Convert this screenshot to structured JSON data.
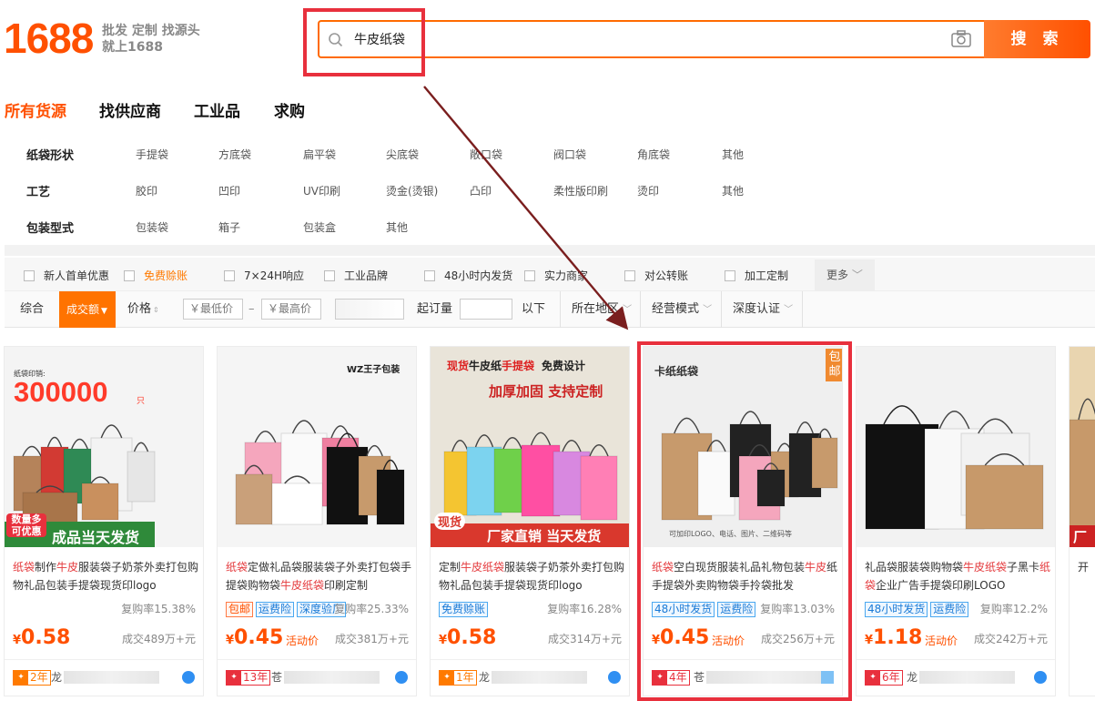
{
  "logo": {
    "number": "1688",
    "slogan_line1": "批发 定制 找源头",
    "slogan_line2": "就上1688"
  },
  "search": {
    "query": "牛皮纸袋",
    "button": "搜 索"
  },
  "tabs": [
    "所有货源",
    "找供应商",
    "工业品",
    "求购"
  ],
  "attributes": [
    {
      "label": "纸袋形状",
      "options": [
        "手提袋",
        "方底袋",
        "扁平袋",
        "尖底袋",
        "敞口袋",
        "阀口袋",
        "角底袋",
        "其他"
      ]
    },
    {
      "label": "工艺",
      "options": [
        "胶印",
        "凹印",
        "UV印刷",
        "烫金(烫银)",
        "凸印",
        "柔性版印刷",
        "烫印",
        "其他"
      ]
    },
    {
      "label": "包装型式",
      "options": [
        "包装袋",
        "箱子",
        "包装盒",
        "其他"
      ]
    }
  ],
  "filters": [
    "新人首单优惠",
    "免费赊账",
    "7×24H响应",
    "工业品牌",
    "48小时内发货",
    "实力商家",
    "对公转账",
    "加工定制"
  ],
  "filter_more": "更多",
  "sort": {
    "general": "综合",
    "volume": "成交额",
    "price": "价格",
    "min_price": "￥最低价",
    "dash": "–",
    "max_price": "￥最高价",
    "moq": "起订量",
    "below": "以下",
    "location": "所在地区",
    "business_mode": "经营模式",
    "certification": "深度认证"
  },
  "products": [
    {
      "title_parts": [
        [
          "纸袋",
          true
        ],
        [
          "制作",
          false
        ],
        [
          "牛皮",
          true
        ],
        [
          "服装袋子奶茶外卖打包购物礼品包装手提袋现货印logo",
          false
        ]
      ],
      "tags": [],
      "repurchase": "复购率15.38%",
      "price": "0.58",
      "promo": "",
      "sales": "成交489万+元",
      "badge": "2年",
      "seller": "龙",
      "img_overlay": {
        "top_label": "纸袋印销:",
        "big_num": "300000",
        "unit": "只",
        "bottom_left": "数量多\n可优惠",
        "bottom_main": "成品当天发货"
      }
    },
    {
      "title_parts": [
        [
          "纸袋",
          true
        ],
        [
          "定做礼品袋服装袋子外卖打包袋手提袋购物袋",
          false
        ],
        [
          "牛皮纸袋",
          true
        ],
        [
          "印刷定制",
          false
        ]
      ],
      "tags": [
        [
          "包邮",
          true
        ],
        [
          "运费险",
          false
        ],
        [
          "深度验厂",
          false
        ]
      ],
      "repurchase": "复购率25.33%",
      "price": "0.45",
      "promo": "活动价",
      "sales": "成交381万+元",
      "badge": "13年",
      "seller": "苍",
      "img_overlay": {
        "brand": "WZ王子包装"
      }
    },
    {
      "title_parts": [
        [
          "定制",
          false
        ],
        [
          "牛皮纸袋",
          true
        ],
        [
          "服装袋子奶茶外卖打包购物礼品包装手提袋现货印logo",
          false
        ]
      ],
      "tags": [
        [
          "免费赊账",
          false
        ]
      ],
      "repurchase": "复购率16.28%",
      "price": "0.58",
      "promo": "",
      "sales": "成交314万+元",
      "badge": "1年",
      "seller": "龙",
      "img_overlay": {
        "line1a": "现货",
        "line1b": "牛皮纸",
        "line1c": "手提袋",
        "line1d": "免费设计",
        "line2": "加厚加固 支持定制",
        "bottom_tag": "现货",
        "bottom_main": "厂家直销 当天发货"
      }
    },
    {
      "title_parts": [
        [
          "纸袋",
          true
        ],
        [
          "空白现货服装礼品礼物包装",
          false
        ],
        [
          "牛皮",
          true
        ],
        [
          "纸手提袋外卖购物袋手拎袋批发",
          false
        ]
      ],
      "tags": [
        [
          "48小时发货",
          false
        ],
        [
          "运费险",
          false
        ]
      ],
      "repurchase": "复购率13.03%",
      "price": "0.45",
      "promo": "活动价",
      "sales": "成交256万+元",
      "badge": "4年",
      "seller": "苍",
      "img_overlay": {
        "brand": "卡纸纸袋",
        "corner": "包邮",
        "caption": "可加印LOGO、电话、图片、二维码等"
      }
    },
    {
      "title_parts": [
        [
          "礼品袋服装袋购物袋",
          false
        ],
        [
          "牛皮纸袋",
          true
        ],
        [
          "子黑卡",
          false
        ],
        [
          "纸袋",
          true
        ],
        [
          "企业广告手提袋印刷LOGO",
          false
        ]
      ],
      "tags": [
        [
          "48小时发货",
          false
        ],
        [
          "运费险",
          false
        ]
      ],
      "repurchase": "复购率12.2%",
      "price": "1.18",
      "promo": "活动价",
      "sales": "成交242万+元",
      "badge": "6年",
      "seller": "龙",
      "img_overlay": {}
    },
    {
      "title_parts": [
        [
          "开",
          false
        ]
      ],
      "tags": [],
      "repurchase": "",
      "price": "",
      "promo": "",
      "sales": "",
      "badge": "",
      "seller": "",
      "img_overlay": {
        "bottom_main": "厂"
      }
    }
  ],
  "colors": {
    "brand": "#ff5000",
    "highlight": "#e8303d",
    "arrow": "#7a1e1e"
  }
}
